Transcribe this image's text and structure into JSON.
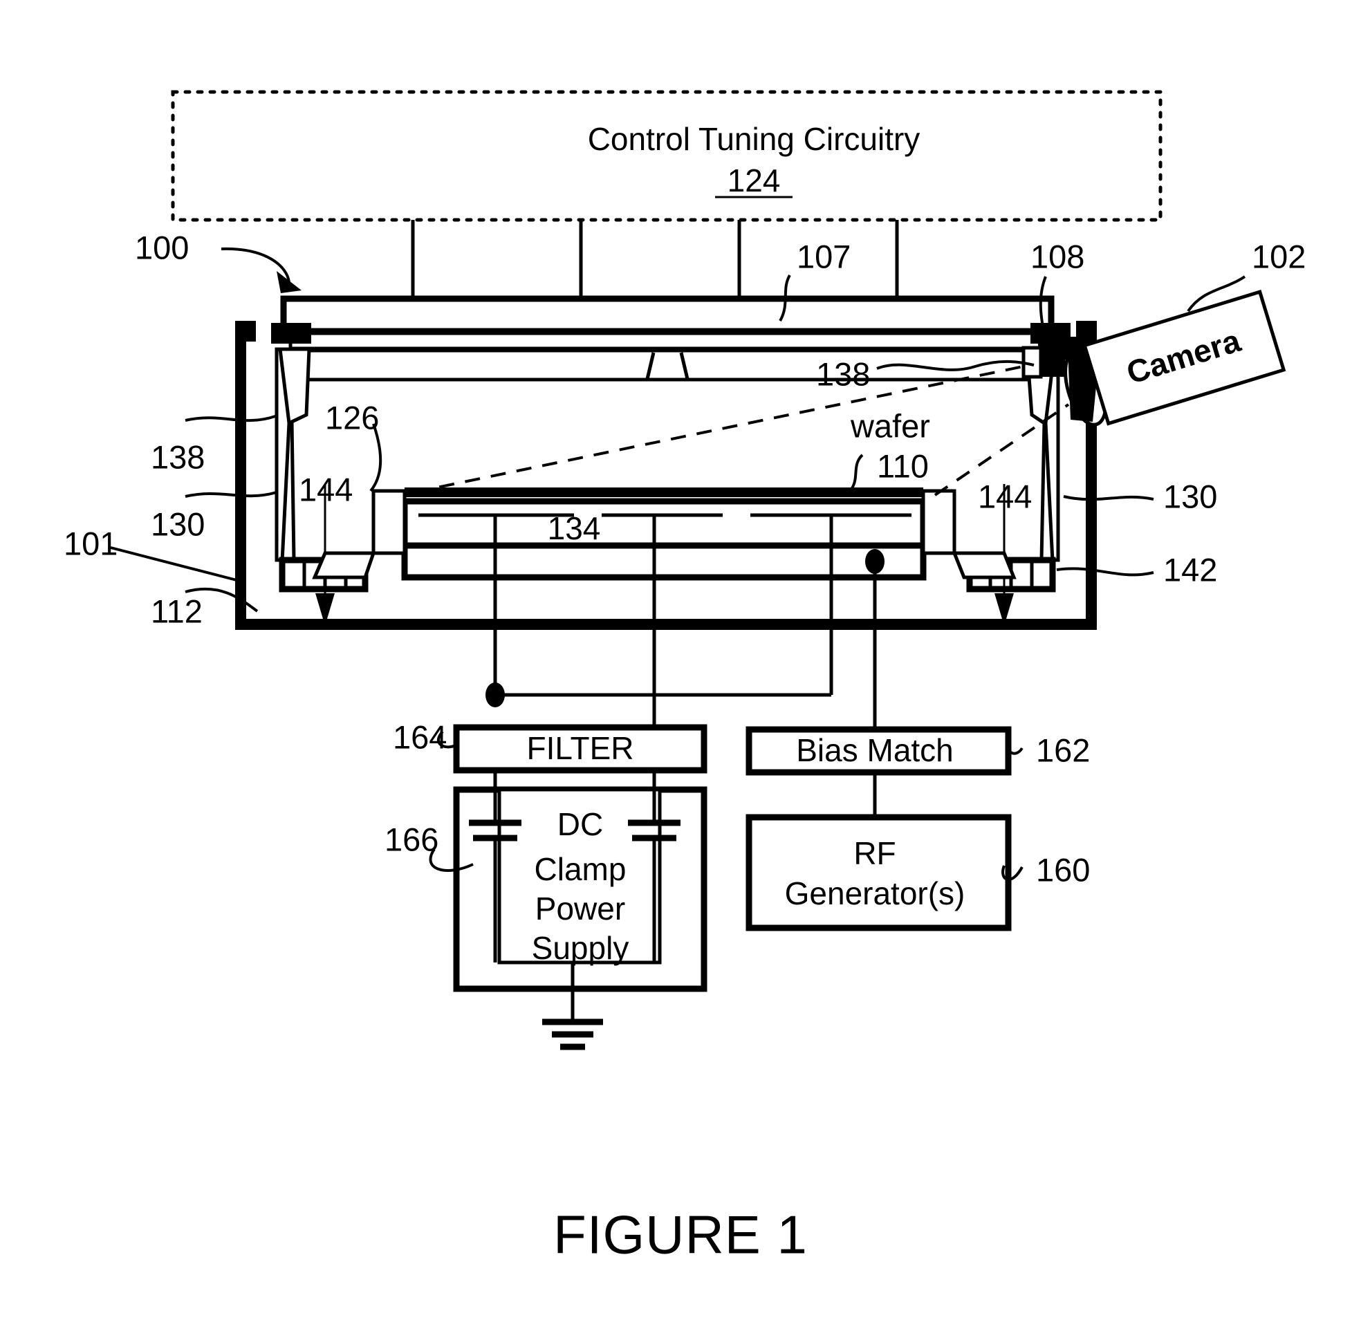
{
  "figure": {
    "caption": "FIGURE 1",
    "type": "patent-diagram"
  },
  "blocks": {
    "control_tuning": {
      "title": "Control Tuning Circuitry",
      "ref": "124"
    },
    "filter": {
      "label": "FILTER",
      "ref": "164"
    },
    "dc_clamp": {
      "label_line1": "DC",
      "label_line2": "Clamp",
      "label_line3": "Power",
      "label_line4": "Supply",
      "ref": "166"
    },
    "bias_match": {
      "label": "Bias Match",
      "ref": "162"
    },
    "rf_generator": {
      "label_line1": "RF",
      "label_line2": "Generator(s)",
      "ref": "160"
    },
    "camera": {
      "label": "Camera",
      "ref": "102"
    }
  },
  "reference_numerals": {
    "system": "100",
    "chamber_wall": "101",
    "camera": "102",
    "upper_plate": "107",
    "viewport": "108",
    "wafer_ref": "110",
    "wafer_text": "wafer",
    "chamber_bottom": "112",
    "control_circuitry": "124",
    "liner": "126",
    "shield_left": "130",
    "shield_right": "130",
    "pedestal": "134",
    "gap_left": "138",
    "gap_right": "138",
    "exhaust_plate": "142",
    "flow_left": "144",
    "flow_right": "144",
    "rf_gen": "160",
    "bias_match": "162",
    "filter": "164",
    "dc_supply": "166"
  },
  "colors": {
    "ink": "#000000",
    "paper": "#ffffff"
  }
}
